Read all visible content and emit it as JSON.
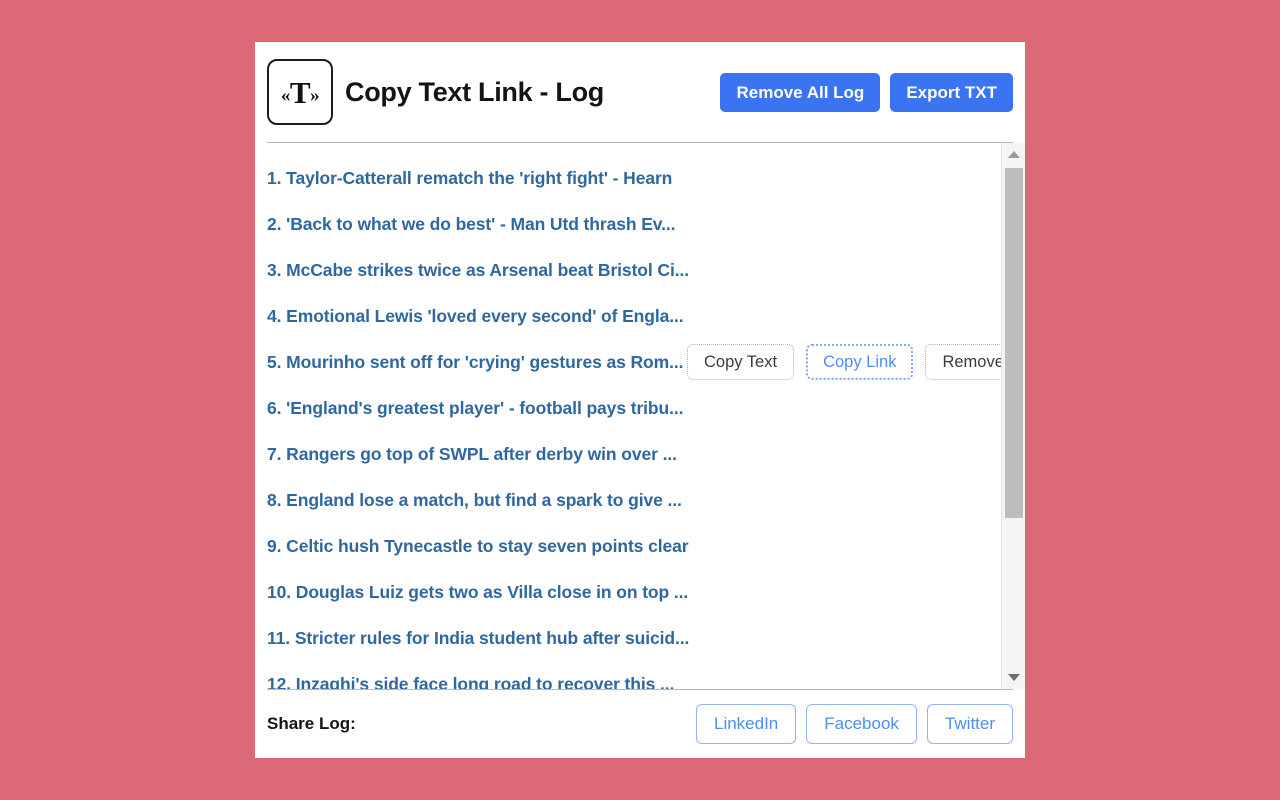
{
  "theme": {
    "page_background": "#dc6a76",
    "card_background": "#ffffff",
    "primary_button": "#3b74f2",
    "link_color": "#30679f",
    "share_button_color": "#4d8ef0",
    "scrollbar_thumb": "#bdbdbd"
  },
  "header": {
    "logo_glyph_left": "«",
    "logo_glyph_main": "T",
    "logo_glyph_right": "»",
    "logo_icon_name": "copy-text-link-logo",
    "title": "Copy Text Link - Log",
    "buttons": [
      {
        "label": "Remove All Log",
        "name": "remove-all-log-button"
      },
      {
        "label": "Export TXT",
        "name": "export-txt-button"
      }
    ]
  },
  "log": {
    "row_actions": {
      "copy_text": "Copy Text",
      "copy_link": "Copy Link",
      "remove": "Remove"
    },
    "active_row_index": 4,
    "items": [
      {
        "index": "1.",
        "text": "Taylor-Catterall rematch the 'right fight' - Hearn"
      },
      {
        "index": "2.",
        "text": "'Back to what we do best' - Man Utd thrash Ev..."
      },
      {
        "index": "3.",
        "text": "McCabe strikes twice as Arsenal beat Bristol Ci..."
      },
      {
        "index": "4.",
        "text": "Emotional Lewis 'loved every second' of Engla..."
      },
      {
        "index": "5.",
        "text": "Mourinho sent off for 'crying' gestures as Rom..."
      },
      {
        "index": "6.",
        "text": "'England's greatest player' - football pays tribu..."
      },
      {
        "index": "7.",
        "text": "Rangers go top of SWPL after derby win over ..."
      },
      {
        "index": "8.",
        "text": "England lose a match, but find a spark to give ..."
      },
      {
        "index": "9.",
        "text": "Celtic hush Tynecastle to stay seven points clear"
      },
      {
        "index": "10.",
        "text": "Douglas Luiz gets two as Villa close in on top ..."
      },
      {
        "index": "11.",
        "text": "Stricter rules for India student hub after suicid..."
      },
      {
        "index": "12.",
        "text": "Inzaghi's side face long road to recover this ..."
      }
    ]
  },
  "scrollbar": {
    "up_arrow_name": "scroll-up-arrow",
    "down_arrow_name": "scroll-down-arrow",
    "thumb_name": "scrollbar-thumb"
  },
  "footer": {
    "share_label": "Share Log:",
    "buttons": [
      {
        "label": "LinkedIn",
        "name": "share-linkedin-button"
      },
      {
        "label": "Facebook",
        "name": "share-facebook-button"
      },
      {
        "label": "Twitter",
        "name": "share-twitter-button"
      }
    ]
  }
}
